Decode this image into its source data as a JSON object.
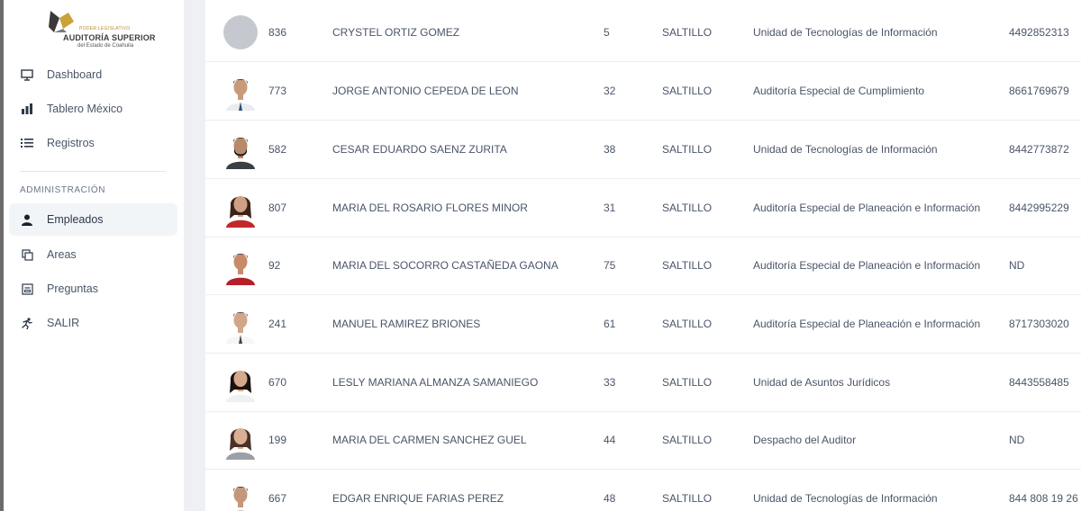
{
  "brand": {
    "line1": "PODER LEGISLATIVO",
    "line2": "AUDITORÍA SUPERIOR",
    "line3": "del Estado de Coahuila"
  },
  "sidebar": {
    "items": [
      {
        "label": "Dashboard",
        "icon": "monitor-icon"
      },
      {
        "label": "Tablero México",
        "icon": "bar-chart-icon"
      },
      {
        "label": "Registros",
        "icon": "list-icon"
      }
    ],
    "section_title": "ADMINISTRACIÓN",
    "admin_items": [
      {
        "label": "Empleados",
        "icon": "user-icon",
        "active": true
      },
      {
        "label": "Areas",
        "icon": "copy-icon"
      },
      {
        "label": "Preguntas",
        "icon": "form-icon"
      },
      {
        "label": "SALIR",
        "icon": "running-icon"
      }
    ]
  },
  "employees": [
    {
      "id": "836",
      "name": "CRYSTEL ORTIZ GOMEZ",
      "age": "5",
      "city": "SALTILLO",
      "area": "Unidad de Tecnologías de Información",
      "phone": "4492852313",
      "photo": "placeholder"
    },
    {
      "id": "773",
      "name": "JORGE ANTONIO CEPEDA DE LEON",
      "age": "32",
      "city": "SALTILLO",
      "area": "Auditoría Especial de Cumplimiento",
      "phone": "8661769679",
      "photo": "man-suit"
    },
    {
      "id": "582",
      "name": "CESAR EDUARDO SAENZ ZURITA",
      "age": "38",
      "city": "SALTILLO",
      "area": "Unidad de Tecnologías de Información",
      "phone": "8442773872",
      "photo": "man-beard"
    },
    {
      "id": "807",
      "name": "MARIA DEL ROSARIO FLORES MINOR",
      "age": "31",
      "city": "SALTILLO",
      "area": "Auditoría Especial de Planeación e Información",
      "phone": "8442995229",
      "photo": "woman-red"
    },
    {
      "id": "92",
      "name": "MARIA DEL SOCORRO CASTAÑEDA GAONA",
      "age": "75",
      "city": "SALTILLO",
      "area": "Auditoría Especial de Planeación e Información",
      "phone": "ND",
      "photo": "man-red"
    },
    {
      "id": "241",
      "name": "MANUEL RAMIREZ BRIONES",
      "age": "61",
      "city": "SALTILLO",
      "area": "Auditoría Especial de Planeación e Información",
      "phone": "8717303020",
      "photo": "man-white"
    },
    {
      "id": "670",
      "name": "LESLY MARIANA ALMANZA SAMANIEGO",
      "age": "33",
      "city": "SALTILLO",
      "area": "Unidad de Asuntos Jurídicos",
      "phone": "8443558485",
      "photo": "woman-dark"
    },
    {
      "id": "199",
      "name": "MARIA DEL CARMEN SANCHEZ GUEL",
      "age": "44",
      "city": "SALTILLO",
      "area": "Despacho del Auditor",
      "phone": "ND",
      "photo": "woman-grey"
    },
    {
      "id": "667",
      "name": "EDGAR ENRIQUE FARIAS PEREZ",
      "age": "48",
      "city": "SALTILLO",
      "area": "Unidad de Tecnologías de Información",
      "phone": "844 808 19 26",
      "photo": "man-dark"
    }
  ]
}
